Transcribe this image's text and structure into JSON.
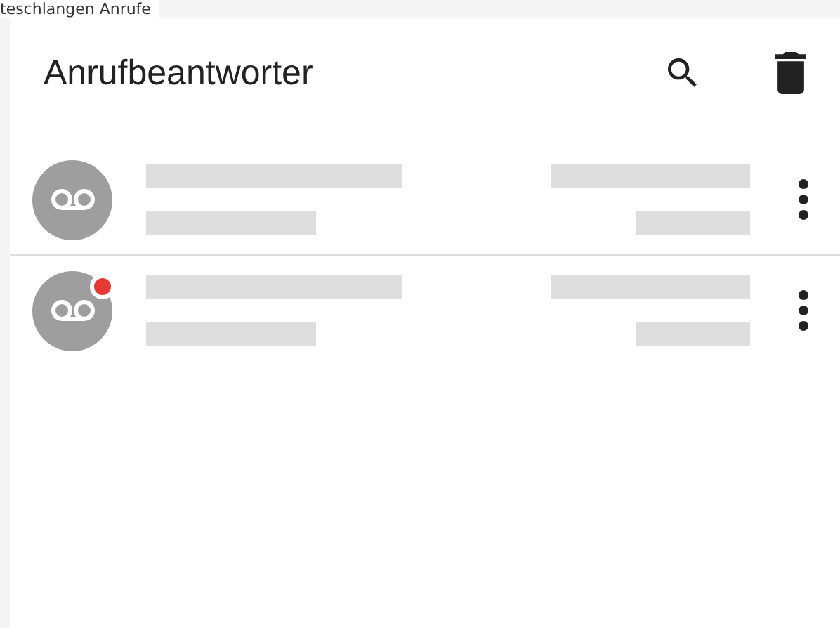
{
  "previous_section": {
    "title": "teschlangen Anrufe"
  },
  "header": {
    "title": "Anrufbeantworter"
  },
  "messages": [
    {
      "unread": false
    },
    {
      "unread": true
    }
  ]
}
